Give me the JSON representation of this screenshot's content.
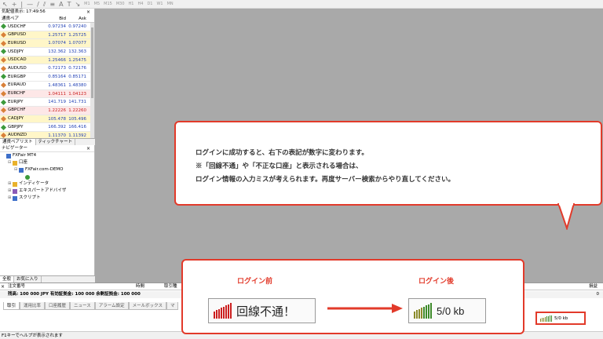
{
  "market_watch": {
    "title": "気配値表示: 17:49:56",
    "headers": {
      "symbol": "通貨ペア",
      "bid": "Bid",
      "ask": "Ask"
    },
    "rows": [
      {
        "symbol": "USDCHF",
        "bid": "0.97234",
        "ask": "0.97240",
        "style": "normal"
      },
      {
        "symbol": "GBPUSD",
        "bid": "1.25717",
        "ask": "1.25725",
        "style": "alt"
      },
      {
        "symbol": "EURUSD",
        "bid": "1.07074",
        "ask": "1.07077",
        "style": "alt"
      },
      {
        "symbol": "USDJPY",
        "bid": "132.362",
        "ask": "132.363",
        "style": "normal"
      },
      {
        "symbol": "USDCAD",
        "bid": "1.25466",
        "ask": "1.25475",
        "style": "alt"
      },
      {
        "symbol": "AUDUSD",
        "bid": "0.72173",
        "ask": "0.72176",
        "style": "normal"
      },
      {
        "symbol": "EURGBP",
        "bid": "0.85164",
        "ask": "0.85171",
        "style": "normal"
      },
      {
        "symbol": "EURAUD",
        "bid": "1.48361",
        "ask": "1.48380",
        "style": "normal"
      },
      {
        "symbol": "EURCHF",
        "bid": "1.04111",
        "ask": "1.04123",
        "style": "down"
      },
      {
        "symbol": "EURJPY",
        "bid": "141.719",
        "ask": "141.731",
        "style": "normal"
      },
      {
        "symbol": "GBPCHF",
        "bid": "1.22226",
        "ask": "1.22260",
        "style": "down"
      },
      {
        "symbol": "CADJPY",
        "bid": "105.478",
        "ask": "105.496",
        "style": "alt"
      },
      {
        "symbol": "GBPJPY",
        "bid": "166.392",
        "ask": "166.416",
        "style": "normal"
      },
      {
        "symbol": "AUDNZD",
        "bid": "1.11370",
        "ask": "1.11392",
        "style": "alt"
      }
    ],
    "tabs": [
      "通貨ペアリスト",
      "ティックチャート"
    ]
  },
  "navigator": {
    "title": "ナビゲーター",
    "items": [
      {
        "label": "FXFair MT4",
        "indent": 0,
        "icon": "blue",
        "pm": ""
      },
      {
        "label": "口座",
        "indent": 1,
        "icon": "yellow",
        "pm": "⊟"
      },
      {
        "label": "FXFair.com-DEMO",
        "indent": 2,
        "icon": "blue",
        "pm": "⊟"
      },
      {
        "label": "",
        "indent": 3,
        "icon": "green",
        "pm": ""
      },
      {
        "label": "インディケータ",
        "indent": 1,
        "icon": "yellow",
        "pm": "⊞"
      },
      {
        "label": "エキスパートアドバイザ",
        "indent": 1,
        "icon": "purple",
        "pm": "⊞"
      },
      {
        "label": "スクリプト",
        "indent": 1,
        "icon": "blue",
        "pm": "⊞"
      }
    ],
    "tabs": [
      "全般",
      "お気に入り"
    ]
  },
  "terminal": {
    "headers": {
      "order": "注文番号",
      "time": "時間",
      "type": "取引種",
      "profit": "損益"
    },
    "balance": "残高: 100 000 JPY 有効証拠金: 100 000 余剰証拠金: 100 000",
    "balance_value": "0",
    "tabs": [
      "取引",
      "運用比率",
      "口座履歴",
      "ニュース",
      "アラーム設定",
      "メールボックス",
      "マ"
    ]
  },
  "statusbar": {
    "help": "F1キーでヘルプが表示されます"
  },
  "callout_main": {
    "lines": [
      "ログインに成功すると、右下の表記が数字に変わります。",
      "※「回線不通」や「不正な口座」と表示される場合は、",
      "ログイン情報の入力ミスが考えられます。再度サーバー検索からやり直してください。"
    ]
  },
  "callout_status": {
    "before_label": "ログイン前",
    "after_label": "ログイン後",
    "before_text": "回線不通！",
    "after_text": "5/0 kb"
  },
  "status_mini": {
    "text": "5/0 kb"
  },
  "colors": {
    "accent": "#e23a2a",
    "bar_red": "#cc1f1f",
    "bar_green": "#3d8a2a",
    "bar_olive": "#8a8a2a"
  }
}
